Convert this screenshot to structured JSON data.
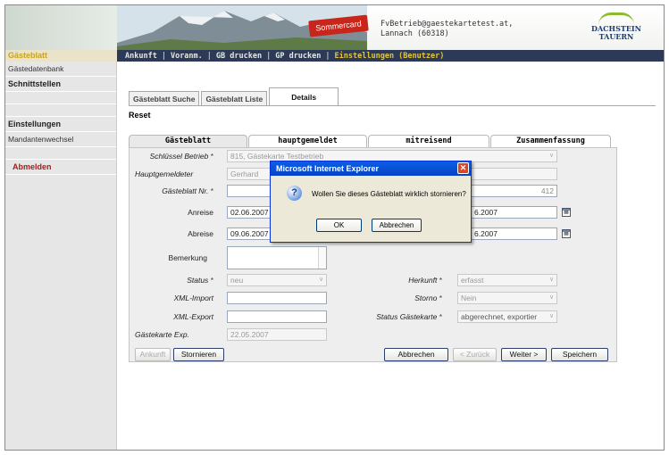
{
  "header": {
    "sommercard": "Sommercard",
    "email": "FvBetrieb@gaestekartetest.at,",
    "location": "Lannach (60318)",
    "logo_line1": "DACHSTEIN",
    "logo_line2": "TAUERN"
  },
  "topnav": {
    "section": "Gästeblatt",
    "items": [
      "Ankunft",
      "Voranm.",
      "GB drucken",
      "GP drucken",
      "Einstellungen (Benutzer)"
    ],
    "separator": "|"
  },
  "sidebar": {
    "items": [
      "Gästedatenbank",
      "Schnittstellen",
      "Einstellungen",
      "Mandantenwechsel",
      "Abmelden"
    ]
  },
  "tabs_top": [
    "Gästeblatt Suche",
    "Gästeblatt Liste",
    "Details"
  ],
  "reset": "Reset",
  "tabs_sub": [
    "Gästeblatt",
    "hauptgemeldet",
    "mitreisend",
    "Zusammenfassung"
  ],
  "form": {
    "schluessel_label": "Schlüssel Betrieb",
    "schluessel_value": "815, Gästekarte Testbetrieb",
    "hauptgemeldeter_label": "Hauptgemeldeter",
    "hauptgemeldeter_value": "Gerhard",
    "gb_nr_label": "Gästeblatt Nr.",
    "gb_nr_value": "412",
    "anreise_label": "Anreise",
    "anreise_from": "02.06.2007",
    "anreise_to": "6.2007",
    "abreise_label": "Abreise",
    "abreise_from": "09.06.2007",
    "abreise_to": "6.2007",
    "bemerkung_label": "Bemerkung",
    "status_label": "Status",
    "status_value": "neu",
    "herkunft_label": "Herkunft",
    "herkunft_value": "erfasst",
    "xml_import_label": "XML-Import",
    "storno_label": "Storno",
    "storno_value": "Nein",
    "xml_export_label": "XML-Export",
    "status_gk_label": "Status Gästekarte",
    "status_gk_value": "abgerechnet, exportier",
    "gk_exp_label": "Gästekarte Exp.",
    "gk_exp_value": "22.05.2007",
    "required_mark": "*",
    "calendar_glyph": "▦"
  },
  "buttons": {
    "ankunft": "Ankunft",
    "stornieren": "Stornieren",
    "abbrechen": "Abbrechen",
    "zurueck": "< Zurück",
    "weiter": "Weiter >",
    "speichern": "Speichern"
  },
  "dialog": {
    "title": "Microsoft Internet Explorer",
    "message": "Wollen Sie dieses Gästeblatt wirklich stornieren?",
    "ok": "OK",
    "cancel": "Abbrechen",
    "close": "✕",
    "icon_glyph": "?"
  },
  "colors": {
    "nav_bg": "#2c3a57",
    "active_nav": "#e2c63d",
    "abmelden": "#a81b1b",
    "dialog_title": "#0a5fe6"
  }
}
